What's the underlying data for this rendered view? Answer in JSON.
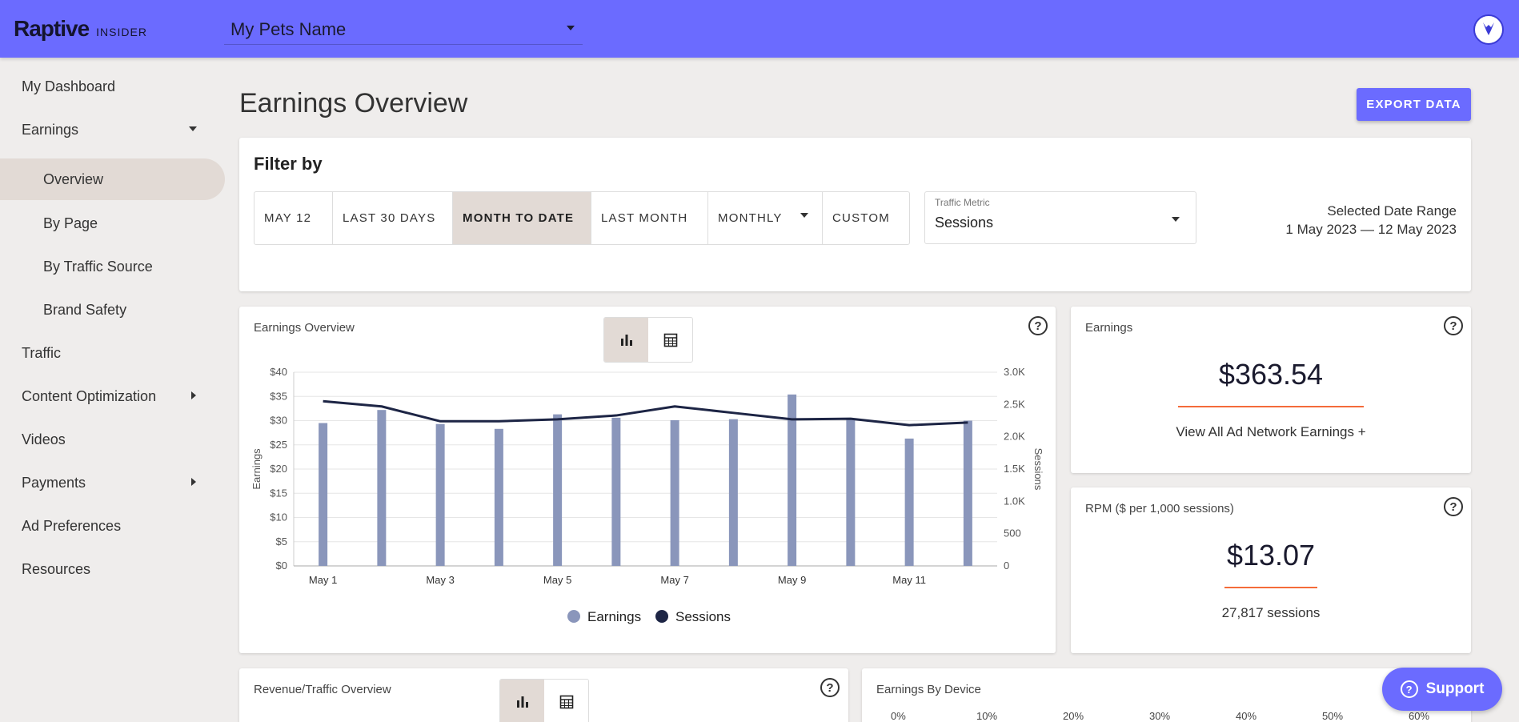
{
  "app": {
    "brand": "Raptive",
    "brand_sub": "INSIDER"
  },
  "site_select": {
    "value": "My Pets Name"
  },
  "sidebar": {
    "items": [
      {
        "label": "My Dashboard"
      },
      {
        "label": "Earnings"
      },
      {
        "label": "Overview"
      },
      {
        "label": "By Page"
      },
      {
        "label": "By Traffic Source"
      },
      {
        "label": "Brand Safety"
      },
      {
        "label": "Traffic"
      },
      {
        "label": "Content Optimization"
      },
      {
        "label": "Videos"
      },
      {
        "label": "Payments"
      },
      {
        "label": "Ad Preferences"
      },
      {
        "label": "Resources"
      }
    ]
  },
  "page": {
    "title": "Earnings Overview",
    "export_label": "EXPORT DATA"
  },
  "filter": {
    "title": "Filter by",
    "options": [
      "MAY 12",
      "LAST 30 DAYS",
      "MONTH TO DATE",
      "LAST MONTH",
      "MONTHLY",
      "CUSTOM"
    ],
    "selected": "MONTH TO DATE",
    "metric_label": "Traffic Metric",
    "metric_value": "Sessions",
    "date_range_label": "Selected Date Range",
    "date_range_value": "1 May 2023 — 12 May 2023"
  },
  "earnings_chart": {
    "title": "Earnings Overview"
  },
  "earnings_card": {
    "title": "Earnings",
    "value": "$363.54",
    "link": "View All Ad Network Earnings +"
  },
  "rpm_card": {
    "title": "RPM ($ per 1,000 sessions)",
    "value": "$13.07",
    "sub": "27,817 sessions"
  },
  "revenue_traffic": {
    "title": "Revenue/Traffic Overview"
  },
  "device_card": {
    "title": "Earnings By Device",
    "axis": [
      "0%",
      "10%",
      "20%",
      "30%",
      "40%",
      "50%",
      "60%"
    ]
  },
  "support": {
    "label": "Support"
  },
  "colors": {
    "accent": "#6b6bff",
    "bar": "#8a96bb",
    "line": "#1d2545",
    "underline": "#f46b3a",
    "selected": "#e2dad5"
  },
  "chart_data": {
    "type": "bar",
    "categories": [
      "May 1",
      "May 2",
      "May 3",
      "May 4",
      "May 5",
      "May 6",
      "May 7",
      "May 8",
      "May 9",
      "May 10",
      "May 11",
      "May 12"
    ],
    "x_tick_labels": [
      "May 1",
      "May 3",
      "May 5",
      "May 7",
      "May 9",
      "May 11"
    ],
    "series": [
      {
        "name": "Earnings",
        "type": "bar",
        "axis": "left",
        "values": [
          29.5,
          32.2,
          29.3,
          28.3,
          31.3,
          30.6,
          30.1,
          30.3,
          35.4,
          30.2,
          26.3,
          30.0
        ]
      },
      {
        "name": "Sessions",
        "type": "line",
        "axis": "right",
        "values": [
          2550,
          2470,
          2240,
          2240,
          2270,
          2330,
          2470,
          2370,
          2270,
          2280,
          2180,
          2220
        ]
      }
    ],
    "ylabel": "Earnings",
    "y2label": "Sessions",
    "ylim": [
      0,
      40
    ],
    "y2lim": [
      0,
      3000
    ],
    "y_ticks": [
      "$0",
      "$5",
      "$10",
      "$15",
      "$20",
      "$25",
      "$30",
      "$35",
      "$40"
    ],
    "y2_ticks": [
      "0",
      "500",
      "1.0K",
      "1.5K",
      "2.0K",
      "2.5K",
      "3.0K"
    ],
    "legend": "bottom",
    "grid": true
  }
}
